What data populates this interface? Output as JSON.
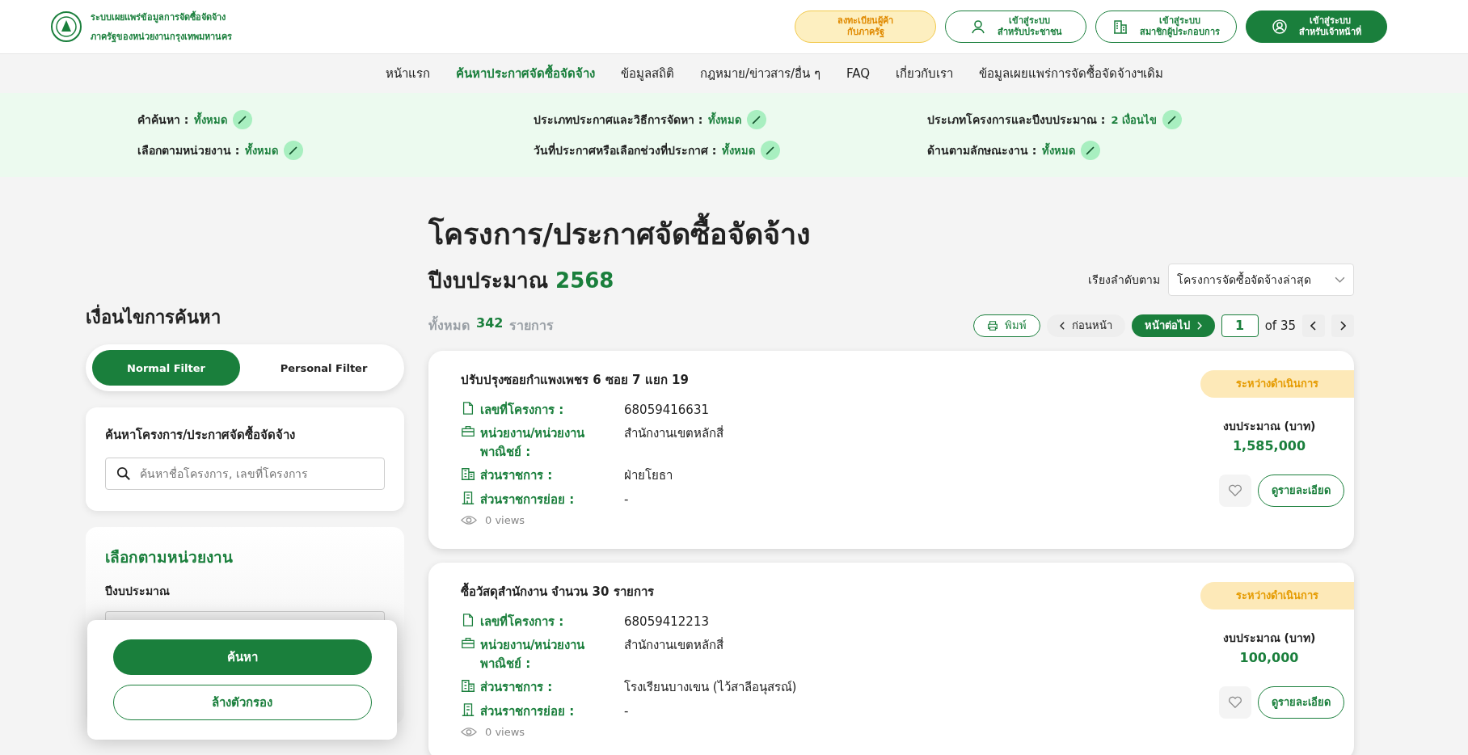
{
  "header": {
    "site_title": [
      "ระบบเผยแพร่ข้อมูลการจัดซื้อจัดจ้าง",
      "ภาครัฐของหน่วยงานกรุงเทพมหานคร"
    ],
    "buttons": [
      {
        "kind": "register",
        "label": "ลงทะเบียนผู้ค้า\nกับภาครัฐ"
      },
      {
        "kind": "person",
        "label": "เข้าสู่ระบบ\nสำหรับประชาชน"
      },
      {
        "kind": "company",
        "label": "เข้าสู่ระบบ\nสมาชิกผู้ประกอบการ"
      },
      {
        "kind": "staff",
        "label": "เข้าสู่ระบบ\nสำหรับเจ้าหน้าที่"
      }
    ]
  },
  "nav": [
    {
      "label": "หน้าแรก",
      "selected": false
    },
    {
      "label": "ค้นหาประกาศจัดซื้อจัดจ้าง",
      "selected": true
    },
    {
      "label": "ข้อมูลสถิติ",
      "selected": false
    },
    {
      "label": "กฎหมาย/ข่าวสาร/อื่น ๆ",
      "selected": false
    },
    {
      "label": "FAQ",
      "selected": false
    },
    {
      "label": "เกี่ยวกับเรา",
      "selected": false
    },
    {
      "label": "ข้อมูลเผยแพร่การจัดซื้อจัดจ้างฯเดิม",
      "selected": false
    }
  ],
  "filters": [
    {
      "label": "คำค้นหา :",
      "value": "ทั้งหมด"
    },
    {
      "label": "ประเภทประกาศและวิธีการจัดหา :",
      "value": "ทั้งหมด"
    },
    {
      "label": "ประเภทโครงการและปีงบประมาณ :",
      "value": "2 เงื่อนไข"
    },
    {
      "label": "เลือกตามหน่วยงาน :",
      "value": "ทั้งหมด"
    },
    {
      "label": "วันที่ประกาศหรือเลือกช่วงที่ประกาศ :",
      "value": "ทั้งหมด"
    },
    {
      "label": "ด้านตามลักษณะงาน :",
      "value": "ทั้งหมด"
    }
  ],
  "sidebar": {
    "title": "เงื่อนไขการค้นหา",
    "tabs": [
      {
        "label": "Normal Filter",
        "selected": true
      },
      {
        "label": "Personal Filter",
        "selected": false
      }
    ],
    "search": {
      "title": "ค้นหาโครงการ/ประกาศจัดซื้อจัดจ้าง",
      "placeholder": "ค้นหาชื่อโครงการ, เลขที่โครงการ"
    },
    "unit": {
      "title": "เลือกตามหน่วยงาน",
      "field_label": "ปีงบประมาณ"
    },
    "actions": {
      "search": "ค้นหา",
      "clear": "ล้างตัวกรอง"
    }
  },
  "main": {
    "title": "โครงการ/ประกาศจัดซื้อจัดจ้าง",
    "year_label": "ปีงบประมาณ",
    "year": "2568",
    "total": {
      "prefix": "ทั้งหมด",
      "count": "342",
      "suffix": "รายการ"
    },
    "sort": {
      "label": "เรียงลำดับตาม",
      "value": "โครงการจัดซื้อจัดจ้างล่าสุด"
    },
    "print": "พิมพ์",
    "prev": "ก่อนหน้า",
    "next": "หน้าต่อไป",
    "page": "1",
    "of": "of 35"
  },
  "cards": [
    {
      "title": "ปรับปรุงซอยกำแพงเพชร 6 ซอย 7 แยก 19",
      "status": "ระหว่างดำเนินการ",
      "fields": [
        {
          "kind": "document",
          "label": "เลขที่โครงการ :",
          "value": "68059416631"
        },
        {
          "kind": "briefcase",
          "label": "หน่วยงาน/หน่วยงาน\nพาณิชย์ :",
          "value": "สำนักงานเขตหลักสี่"
        },
        {
          "kind": "buildings",
          "label": "ส่วนราชการ :",
          "value": "ฝ่ายโยธา"
        },
        {
          "kind": "building",
          "label": "ส่วนราชการย่อย :",
          "value": "-"
        }
      ],
      "views": "0 views",
      "budget_label": "งบประมาณ (บาท)",
      "budget": "1,585,000",
      "detail": "ดูรายละเอียด"
    },
    {
      "title": "ซื้อวัสดุสำนักงาน จำนวน 30 รายการ",
      "status": "ระหว่างดำเนินการ",
      "fields": [
        {
          "kind": "document",
          "label": "เลขที่โครงการ :",
          "value": "68059412213"
        },
        {
          "kind": "briefcase",
          "label": "หน่วยงาน/หน่วยงาน\nพาณิชย์ :",
          "value": "สำนักงานเขตหลักสี่"
        },
        {
          "kind": "buildings",
          "label": "ส่วนราชการ :",
          "value": "โรงเรียนบางเขน (ไว้สาลีอนุสรณ์)"
        },
        {
          "kind": "building",
          "label": "ส่วนราชการย่อย :",
          "value": "-"
        }
      ],
      "views": "0 views",
      "budget_label": "งบประมาณ (บาท)",
      "budget": "100,000",
      "detail": "ดูรายละเอียด"
    }
  ]
}
